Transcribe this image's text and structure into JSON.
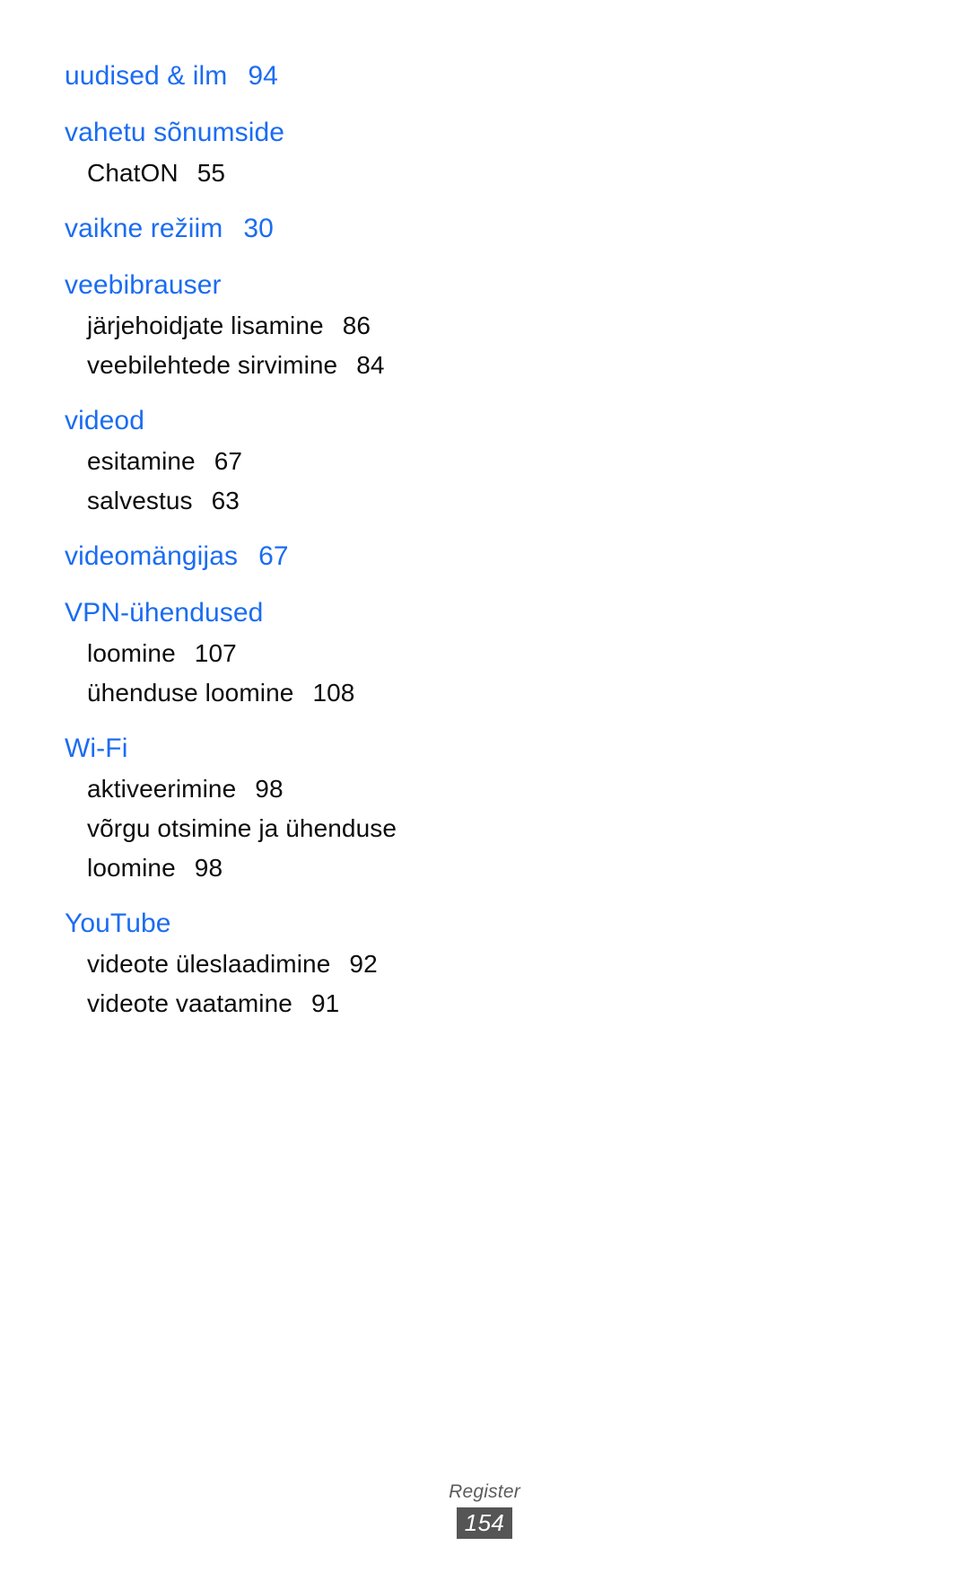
{
  "page": {
    "language": "et",
    "accent_color": "#1b6cf2",
    "body_color": "#0d0d0d",
    "background_color": "#ffffff"
  },
  "index": {
    "groups": [
      {
        "heading": "uudised & ilm",
        "page": "94",
        "entries": []
      },
      {
        "heading": "vahetu sõnumside",
        "page": "",
        "entries": [
          {
            "label": "ChatON",
            "page": "55"
          }
        ]
      },
      {
        "heading": "vaikne režiim",
        "page": "30",
        "entries": []
      },
      {
        "heading": "veebibrauser",
        "page": "",
        "entries": [
          {
            "label": "järjehoidjate lisamine",
            "page": "86"
          },
          {
            "label": "veebilehtede sirvimine",
            "page": "84"
          }
        ]
      },
      {
        "heading": "videod",
        "page": "",
        "entries": [
          {
            "label": "esitamine",
            "page": "67"
          },
          {
            "label": "salvestus",
            "page": "63"
          }
        ]
      },
      {
        "heading": "videomängijas",
        "page": "67",
        "entries": []
      },
      {
        "heading": "VPN-ühendused",
        "page": "",
        "entries": [
          {
            "label": "loomine",
            "page": "107"
          },
          {
            "label": "ühenduse loomine",
            "page": "108"
          }
        ]
      },
      {
        "heading": "Wi-Fi",
        "page": "",
        "entries": [
          {
            "label": "aktiveerimine",
            "page": "98"
          },
          {
            "label": "võrgu otsimine ja ühenduse loomine",
            "page": "98"
          }
        ]
      },
      {
        "heading": "YouTube",
        "page": "",
        "entries": [
          {
            "label": "videote üleslaadimine",
            "page": "92"
          },
          {
            "label": "videote vaatamine",
            "page": "91"
          }
        ]
      }
    ]
  },
  "footer": {
    "label": "Register",
    "page_number": "154"
  }
}
